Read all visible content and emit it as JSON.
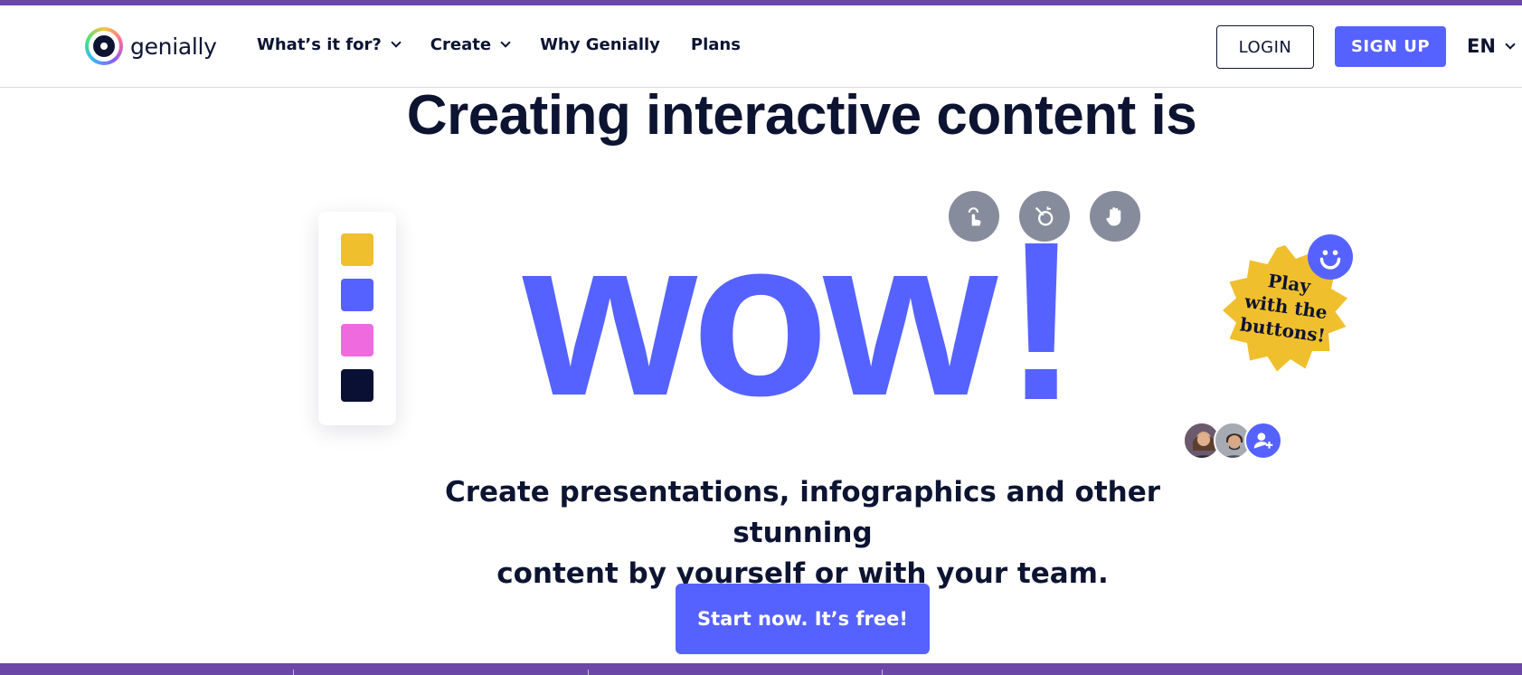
{
  "header": {
    "logo_text": "genially",
    "nav": [
      {
        "label": "What’s it for?",
        "has_dropdown": true
      },
      {
        "label": "Create",
        "has_dropdown": true
      },
      {
        "label": "Why Genially",
        "has_dropdown": false
      },
      {
        "label": "Plans",
        "has_dropdown": false
      }
    ],
    "login_label": "LOGIN",
    "signup_label": "SIGN UP",
    "language": "EN"
  },
  "hero": {
    "title": "Creating interactive content is",
    "word": "wow",
    "exclamation": "!",
    "subtitle_line1": "Create presentations, infographics and other stunning",
    "subtitle_line2": "content by yourself or with your team.",
    "cta_label": "Start now. It’s free!",
    "sticker_lines": [
      "Play",
      "with the",
      "buttons!"
    ],
    "palette_colors": [
      "#f0bf2e",
      "#5662ff",
      "#f06adf",
      "#0a1033"
    ],
    "tools": [
      "tap-icon",
      "magic-wand-icon",
      "hand-icon"
    ]
  },
  "colors": {
    "accent": "#5662ff",
    "text": "#0d1432",
    "brand_strip": "#6b47a8",
    "sticker": "#f0bf2e",
    "tool_button": "#878c9d"
  }
}
